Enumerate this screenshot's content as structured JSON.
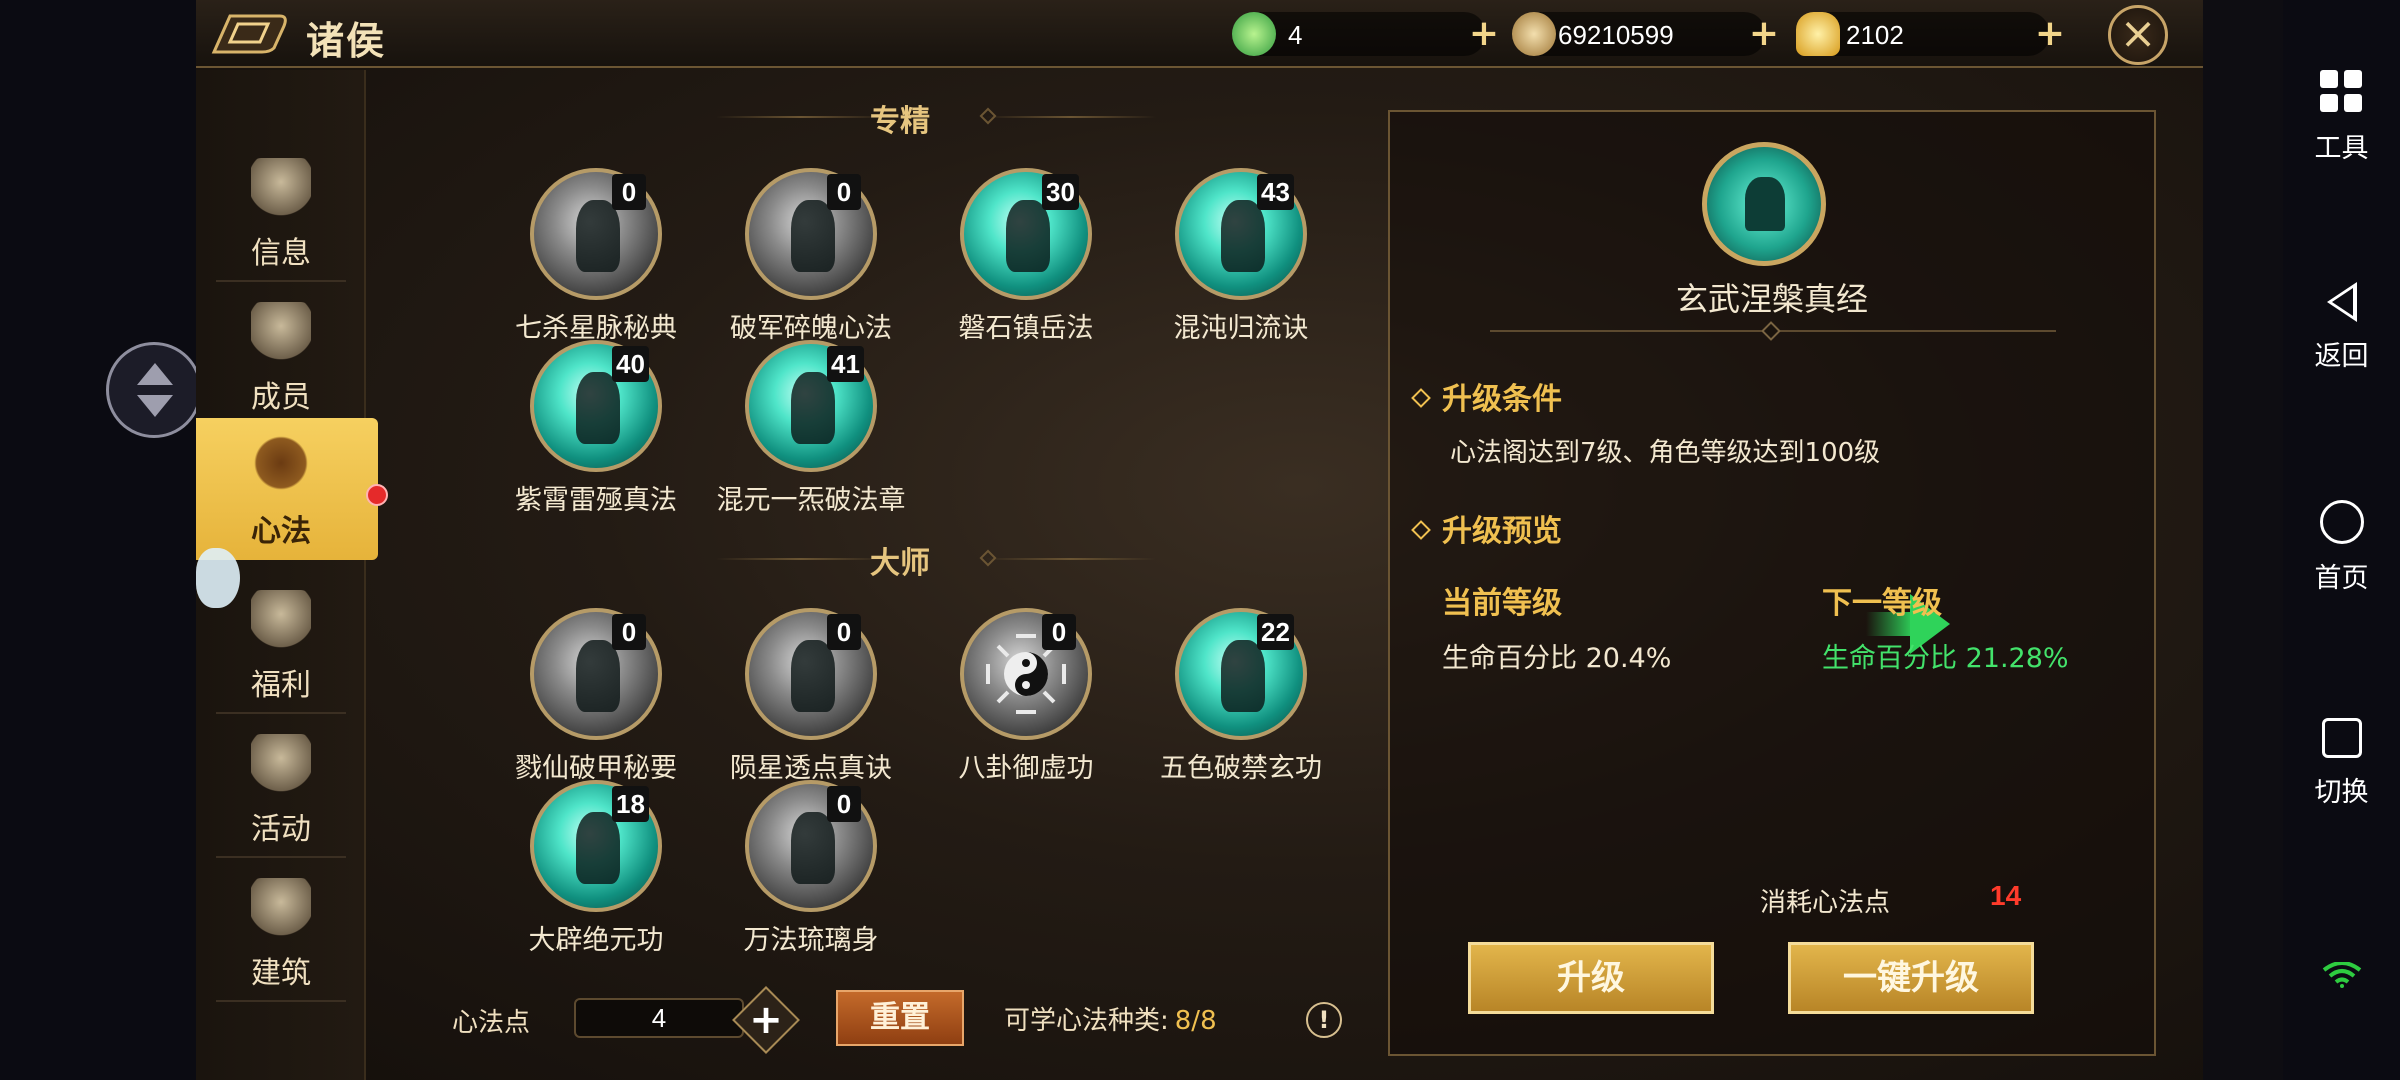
{
  "topbar": {
    "title": "诸侯",
    "resources": [
      {
        "name": "jade",
        "value": "4",
        "color": "#5fd06a"
      },
      {
        "name": "coin",
        "value": "69210599",
        "color": "#c9a45a"
      },
      {
        "name": "gold-ingot",
        "value": "2102",
        "color": "#f0c040"
      }
    ]
  },
  "sidenav": {
    "items": [
      {
        "label": "信息",
        "icon": "scroll-icon"
      },
      {
        "label": "成员",
        "icon": "members-icon"
      },
      {
        "label": "心法",
        "icon": "flame-lotus-icon",
        "active": true
      },
      {
        "label": "福利",
        "icon": "gift-icon"
      },
      {
        "label": "活动",
        "icon": "dragon-icon"
      },
      {
        "label": "建筑",
        "icon": "pavilion-icon"
      }
    ]
  },
  "sections": {
    "specialty": "专精",
    "master": "大师"
  },
  "skills_specialty": [
    {
      "name": "七杀星脉秘典",
      "count": "0",
      "state": "gray"
    },
    {
      "name": "破军碎魄心法",
      "count": "0",
      "state": "gray"
    },
    {
      "name": "磐石镇岳法",
      "count": "30",
      "state": "teal"
    },
    {
      "name": "混沌归流诀",
      "count": "43",
      "state": "teal"
    },
    {
      "name": "紫霄雷殛真法",
      "count": "40",
      "state": "teal"
    },
    {
      "name": "混元一炁破法章",
      "count": "41",
      "state": "teal"
    }
  ],
  "skills_master": [
    {
      "name": "戮仙破甲秘要",
      "count": "0",
      "state": "gray"
    },
    {
      "name": "陨星透点真诀",
      "count": "0",
      "state": "gray"
    },
    {
      "name": "八卦御虚功",
      "count": "0",
      "state": "gray"
    },
    {
      "name": "五色破禁玄功",
      "count": "22",
      "state": "teal"
    },
    {
      "name": "大辟绝元功",
      "count": "18",
      "state": "teal"
    },
    {
      "name": "万法琉璃身",
      "count": "0",
      "state": "gray"
    }
  ],
  "bottom": {
    "points_label": "心法点",
    "points_value": "4",
    "reset_label": "重置",
    "learnable_label": "可学心法种类:",
    "learnable_value": "8/8",
    "info_glyph": "!"
  },
  "detail": {
    "title": "玄武涅槃真经",
    "cond_heading": "升级条件",
    "cond_text": "心法阁达到7级、角色等级达到100级",
    "preview_heading": "升级预览",
    "current_heading": "当前等级",
    "current_value": "生命百分比  20.4%",
    "next_heading": "下一等级",
    "next_value": "生命百分比  21.28%",
    "cost_label": "消耗心法点",
    "cost_value": "14",
    "upgrade_label": "升级",
    "one_click_label": "一键升级"
  },
  "system_nav": {
    "tools": "工具",
    "back": "返回",
    "home": "首页",
    "switch": "切换"
  }
}
